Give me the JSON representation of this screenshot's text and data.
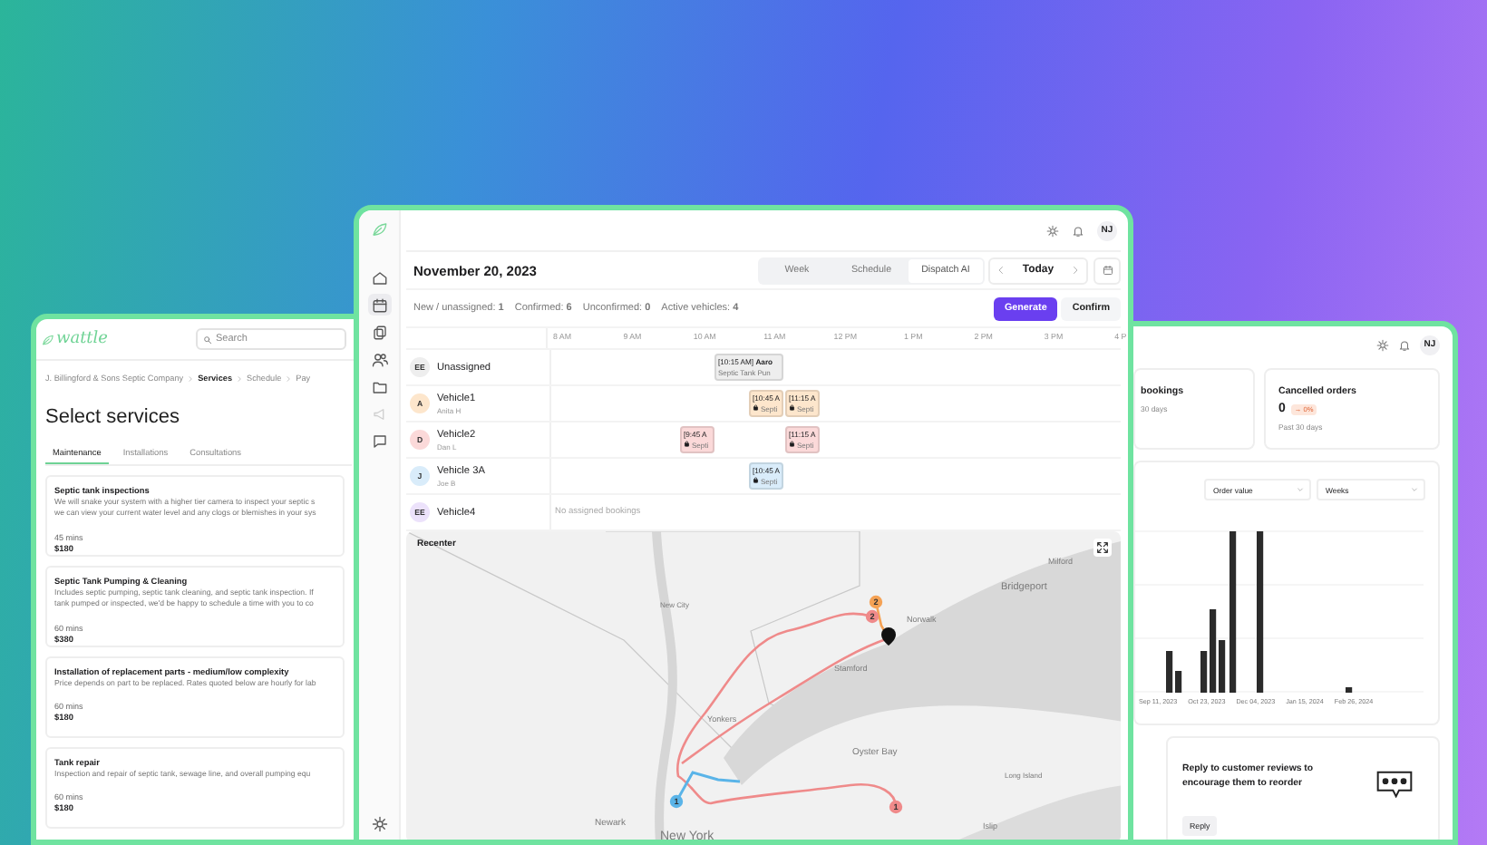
{
  "services_window": {
    "logo": "wattle",
    "search": {
      "placeholder": "Search"
    },
    "breadcrumbs": [
      {
        "label": "J. Billingford & Sons Septic Company",
        "current": false
      },
      {
        "label": "Services",
        "current": true
      },
      {
        "label": "Schedule",
        "current": false
      },
      {
        "label": "Pay",
        "current": false
      }
    ],
    "title": "Select services",
    "tabs": [
      {
        "label": "Maintenance",
        "selected": true
      },
      {
        "label": "Installations",
        "selected": false
      },
      {
        "label": "Consultations",
        "selected": false
      }
    ],
    "services": [
      {
        "name": "Septic tank inspections",
        "description": "We will snake your system with a higher tier camera to inspect your septic s\nwe can view your current water level and any clogs or blemishes in your sys",
        "duration": "45 mins",
        "price": "$180"
      },
      {
        "name": "Septic Tank Pumping & Cleaning",
        "description": "Includes septic pumping, septic tank cleaning, and septic tank inspection. If\ntank pumped or inspected, we'd be happy to schedule a time with you to co",
        "duration": "60 mins",
        "price": "$380"
      },
      {
        "name": "Installation of replacement parts - medium/low complexity",
        "description": "Price depends on part to be replaced. Rates quoted below are hourly for lab",
        "duration": "60 mins",
        "price": "$180"
      },
      {
        "name": "Tank repair",
        "description": "Inspection and repair of septic tank, sewage line, and overall pumping equ",
        "duration": "60 mins",
        "price": "$180"
      }
    ]
  },
  "dispatch_window": {
    "rail": [
      {
        "kind": "home",
        "selected": false,
        "disabled": false
      },
      {
        "kind": "calendar",
        "selected": true,
        "disabled": false
      },
      {
        "kind": "copy",
        "selected": false,
        "disabled": false
      },
      {
        "kind": "people",
        "selected": false,
        "disabled": false
      },
      {
        "kind": "folder",
        "selected": false,
        "disabled": false
      },
      {
        "kind": "megaphone",
        "selected": false,
        "disabled": true
      },
      {
        "kind": "chat",
        "selected": false,
        "disabled": false
      }
    ],
    "user_initials": "NJ",
    "date": "November 20, 2023",
    "views": [
      {
        "label": "Week",
        "selected": false
      },
      {
        "label": "Schedule",
        "selected": false
      },
      {
        "label": "Dispatch AI",
        "selected": true
      }
    ],
    "today_button": "Today",
    "stats": [
      "New / unassigned: **1**",
      "Confirmed: **6**",
      "Unconfirmed: **0**",
      "Active vehicles: **4**"
    ],
    "buttons": [
      {
        "label": "Generate",
        "kind": "primary"
      },
      {
        "label": "Confirm",
        "kind": "secondary"
      }
    ],
    "hours": [
      "8 AM",
      "9 AM",
      "10 AM",
      "11 AM",
      "12 PM",
      "1 PM",
      "2 PM",
      "3 PM",
      "4 P"
    ],
    "vehicles": [
      {
        "initials": "EE",
        "name": "Unassigned",
        "color": "#eeeeee",
        "bookings": [
          {
            "title": "[10:15 AM] **Aaro**",
            "subtitle": "Septic Tank Pun",
            "locked": false
          }
        ]
      },
      {
        "initials": "A",
        "name": "Vehicle1",
        "driver": "Anita H",
        "color": "#fde6cc",
        "bookings": [
          {
            "title": "[10:45 A",
            "subtitle": "Septi",
            "locked": true
          },
          {
            "title": "[11:15 A",
            "subtitle": "Septi",
            "locked": true
          }
        ]
      },
      {
        "initials": "D",
        "name": "Vehicle2",
        "driver": "Dan L",
        "color": "#fbd9d9",
        "bookings": [
          {
            "title": "[9:45 A",
            "subtitle": "Septi",
            "locked": true
          },
          {
            "title": "[11:15 A",
            "subtitle": "Septi",
            "locked": true
          }
        ]
      },
      {
        "initials": "J",
        "name": "Vehicle 3A",
        "driver": "Joe B",
        "color": "#d9ecfa",
        "bookings": [
          {
            "title": "[10:45 A",
            "subtitle": "Septi",
            "locked": true
          }
        ]
      },
      {
        "initials": "EE",
        "name": "Vehicle4",
        "color": "#ece2fb",
        "empty_note": "No assigned bookings"
      }
    ],
    "map": {
      "recenter_button": "Recenter",
      "labels": [
        "Milford",
        "Bridgeport",
        "New City",
        "Norwalk",
        "Stamford",
        "Yonkers",
        "Oyster Bay",
        "Long Island",
        "Newark",
        "New York",
        "Islip"
      ],
      "markers": [
        {
          "label": "2",
          "color": "#f5a255"
        },
        {
          "label": "2",
          "color": "#ef8a8a"
        },
        {
          "label": "1",
          "color": "#5ab4e8"
        },
        {
          "label": "1",
          "color": "#ef8a8a"
        }
      ]
    }
  },
  "orders_window": {
    "user_initials": "NJ",
    "cards": [
      {
        "title": "bookings",
        "note": "30 days"
      },
      {
        "title": "Cancelled orders",
        "value": "0",
        "change": "→ 0%",
        "note": "Past 30 days"
      }
    ],
    "selects": [
      "Order value",
      "Weeks"
    ],
    "x_labels": [
      "Sep 11, 2023",
      "Oct 23, 2023",
      "Dec 04, 2023",
      "Jan 15, 2024",
      "Feb 26, 2024"
    ],
    "review": {
      "text": "Reply to customer reviews to encourage them to reorder",
      "button": "Reply"
    }
  }
}
